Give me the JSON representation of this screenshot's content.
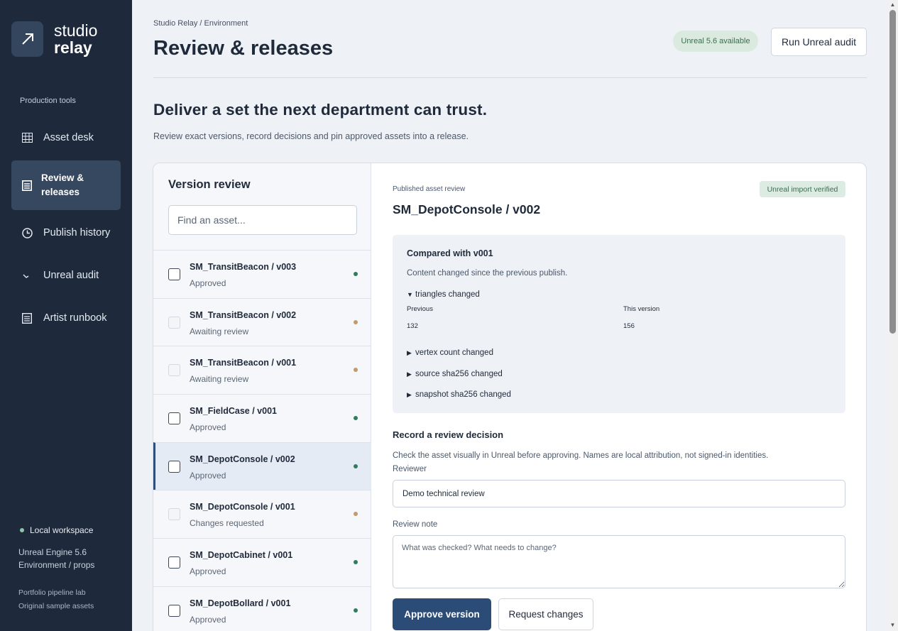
{
  "sidebar": {
    "logo": {
      "line1": "studio",
      "line2": "relay",
      "icon": "arrow-up-right-icon"
    },
    "section_label": "Production tools",
    "items": [
      {
        "label": "Asset desk",
        "icon": "grid-icon"
      },
      {
        "label": "Review & releases",
        "icon": "list-icon"
      },
      {
        "label": "Publish history",
        "icon": "clock-icon"
      },
      {
        "label": "Unreal audit",
        "icon": "pulse-icon"
      },
      {
        "label": "Artist runbook",
        "icon": "document-icon"
      }
    ],
    "footer": {
      "status": "Local workspace",
      "engine": "Unreal Engine 5.6",
      "scope": "Environment / props",
      "lab": "Portfolio pipeline lab",
      "assets": "Original sample assets"
    }
  },
  "header": {
    "breadcrumb": "Studio Relay / Environment",
    "title": "Review & releases",
    "pill": "Unreal 5.6 available",
    "audit_button": "Run Unreal audit"
  },
  "intro": {
    "headline": "Deliver a set the next department can trust.",
    "subline": "Review exact versions, record decisions and pin approved assets into a release."
  },
  "review_list": {
    "title": "Version review",
    "search_placeholder": "Find an asset...",
    "rows": [
      {
        "name": "SM_TransitBeacon / v003",
        "status": "Approved",
        "checkable": true,
        "dot": "#2f7d5b"
      },
      {
        "name": "SM_TransitBeacon / v002",
        "status": "Awaiting review",
        "checkable": false,
        "dot": "#c29a6b"
      },
      {
        "name": "SM_TransitBeacon / v001",
        "status": "Awaiting review",
        "checkable": false,
        "dot": "#c29a6b"
      },
      {
        "name": "SM_FieldCase / v001",
        "status": "Approved",
        "checkable": true,
        "dot": "#2f7d5b"
      },
      {
        "name": "SM_DepotConsole / v002",
        "status": "Approved",
        "checkable": true,
        "dot": "#2f7d5b",
        "selected": true
      },
      {
        "name": "SM_DepotConsole / v001",
        "status": "Changes requested",
        "checkable": false,
        "dot": "#c29a6b"
      },
      {
        "name": "SM_DepotCabinet / v001",
        "status": "Approved",
        "checkable": true,
        "dot": "#2f7d5b"
      },
      {
        "name": "SM_DepotBollard / v001",
        "status": "Approved",
        "checkable": true,
        "dot": "#2f7d5b"
      }
    ]
  },
  "detail": {
    "label": "Published asset review",
    "verified": "Unreal import verified",
    "title": "SM_DepotConsole / v002",
    "compare": {
      "title": "Compared with v001",
      "desc": "Content changed since the previous publish.",
      "expanded": {
        "label": "triangles changed",
        "prev_label": "Previous",
        "this_label": "This version",
        "prev": "132",
        "this": "156"
      },
      "collapsed": [
        "vertex count changed",
        "source sha256 changed",
        "snapshot sha256 changed"
      ]
    },
    "record": {
      "title": "Record a review decision",
      "hint": "Check the asset visually in Unreal before approving. Names are local attribution, not signed-in identities.",
      "reviewer_label": "Reviewer",
      "reviewer_value": "Demo technical review",
      "note_label": "Review note",
      "note_placeholder": "What was checked? What needs to change?",
      "approve": "Approve version",
      "request": "Request changes"
    }
  }
}
